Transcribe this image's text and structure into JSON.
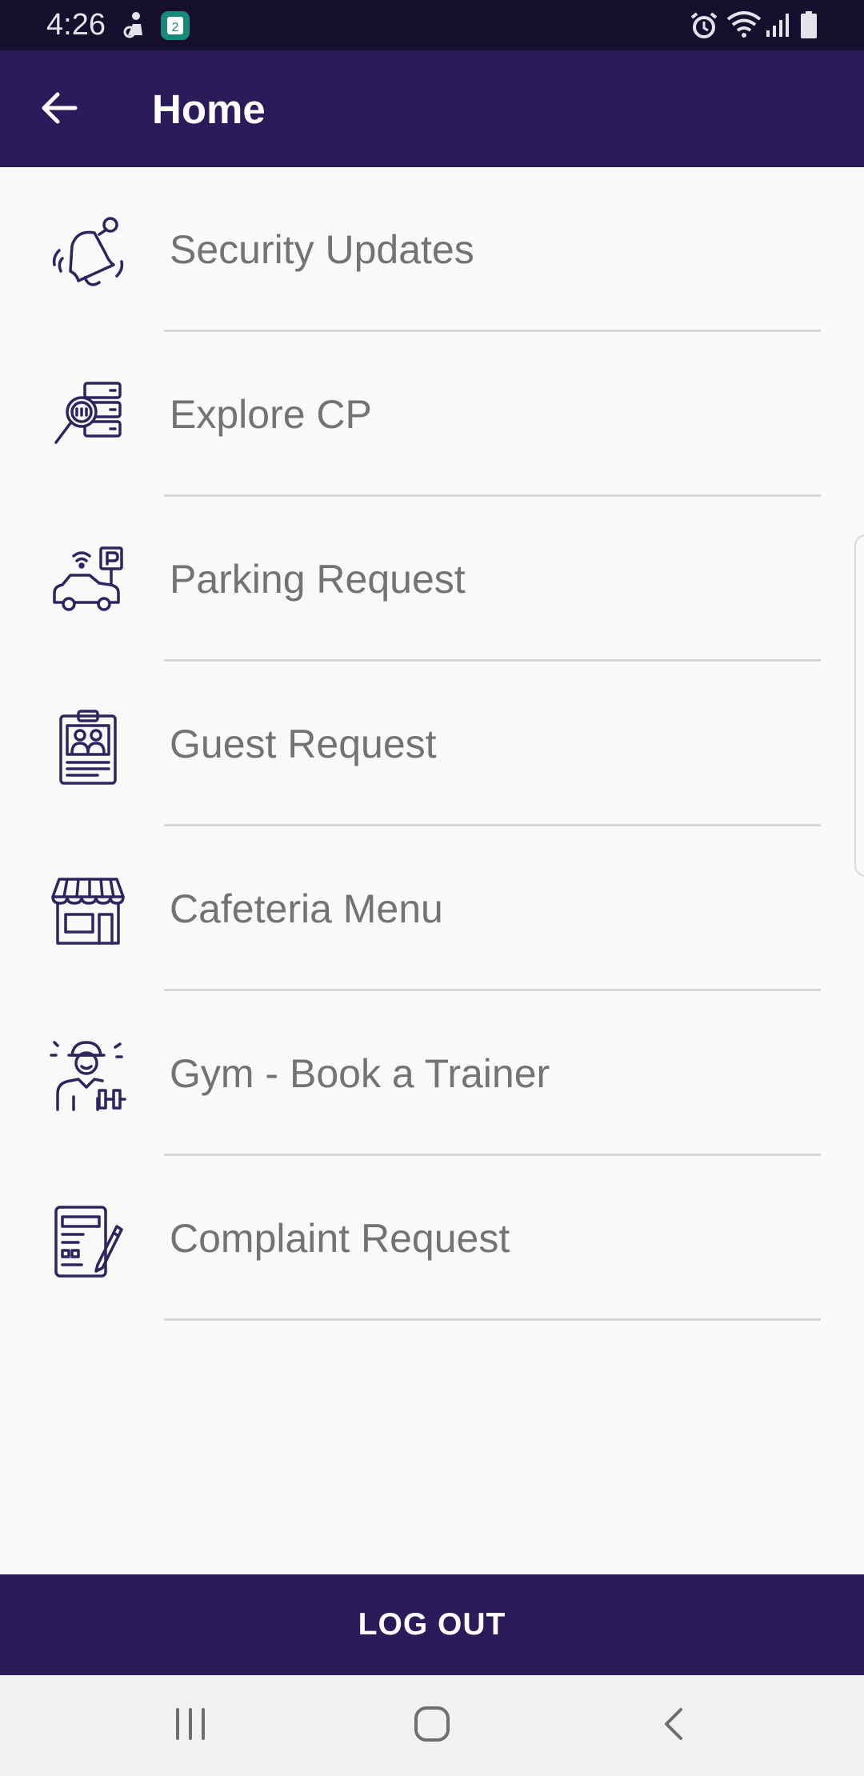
{
  "status_bar": {
    "time": "4:26",
    "notification_badge": "2",
    "icons": [
      "accessibility-icon",
      "calendar-badge-icon",
      "alarm-icon",
      "wifi-icon",
      "signal-icon",
      "battery-icon"
    ]
  },
  "app_bar": {
    "title": "Home",
    "back_icon": "arrow-left-icon"
  },
  "menu": {
    "items": [
      {
        "label": "Security Updates",
        "icon": "bell-icon"
      },
      {
        "label": "Explore CP",
        "icon": "server-search-icon"
      },
      {
        "label": "Parking Request",
        "icon": "car-parking-icon"
      },
      {
        "label": "Guest Request",
        "icon": "guest-badge-icon"
      },
      {
        "label": "Cafeteria Menu",
        "icon": "storefront-icon"
      },
      {
        "label": "Gym - Book a Trainer",
        "icon": "trainer-icon"
      },
      {
        "label": "Complaint Request",
        "icon": "clipboard-pen-icon"
      }
    ]
  },
  "logout": {
    "label": "LOG OUT"
  },
  "nav_bar": {
    "buttons": [
      "recent-apps-icon",
      "home-icon",
      "back-icon"
    ]
  },
  "colors": {
    "primary": "#2b1b5a",
    "status_bar": "#160f2e",
    "icon_stroke": "#2e2560",
    "label_text": "#737373",
    "divider": "#d6d6d6",
    "background": "#f9f9f9"
  }
}
